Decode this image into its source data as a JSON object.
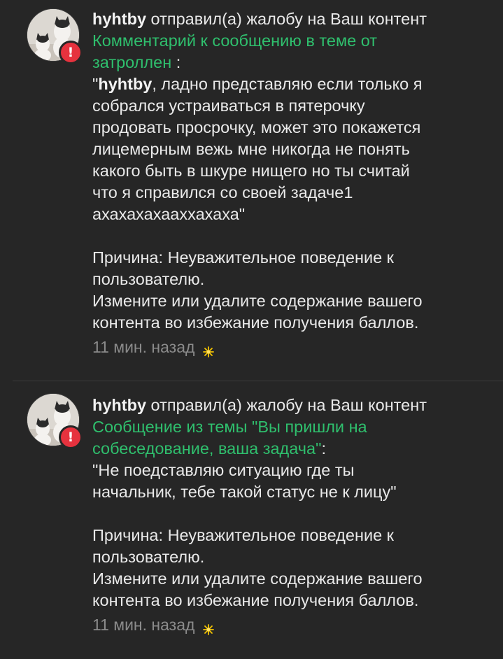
{
  "notifications": [
    {
      "username": "hyhtby",
      "action": " отправил(а) жалобу на Ваш контент",
      "link_lines": [
        "Комментарий к сообщению в теме от",
        "затроллен"
      ],
      "link_suffix": " :",
      "quote_author": "hyhtby",
      "quote_lines": [
        ", ладно представляю если только я",
        "собрался устраиваться в пятерочку",
        "продовать просрочку, может это покажется",
        "лицемерным вежь мне никогда не понять",
        "какого быть в шкуре нищего но ты считай",
        "что я справился со своей задаче1",
        "ахахахахааххахаха\""
      ],
      "reason_lines": [
        "Причина: Неуважительное поведение к",
        "пользователю.",
        "Измените или удалите содержание вашего",
        "контента во избежание получения баллов."
      ],
      "time": "11 мин. назад",
      "badge": "!",
      "avatar_icon": "cats-avatar",
      "status_icon": "sparkle-icon"
    },
    {
      "username": "hyhtby",
      "action": " отправил(а) жалобу на Ваш контент",
      "link_lines": [
        "Сообщение из темы \"Вы пришли на",
        "собеседование, ваша задача\""
      ],
      "link_suffix": ":",
      "quote_lines": [
        "\"Не поедставляю ситуацию где ты",
        "начальник, тебе такой статус не к лицу\""
      ],
      "reason_lines": [
        "Причина: Неуважительное поведение к",
        "пользователю.",
        "Измените или удалите содержание вашего",
        "контента во избежание получения баллов."
      ],
      "time": "11 мин. назад",
      "badge": "!",
      "avatar_icon": "cats-avatar",
      "status_icon": "sparkle-icon"
    }
  ],
  "colors": {
    "background": "#262626",
    "text": "#e9e9e9",
    "link": "#2fbf6d",
    "muted": "#8b8b8b",
    "badge": "#e6323e",
    "sparkle": "#f2c200"
  }
}
